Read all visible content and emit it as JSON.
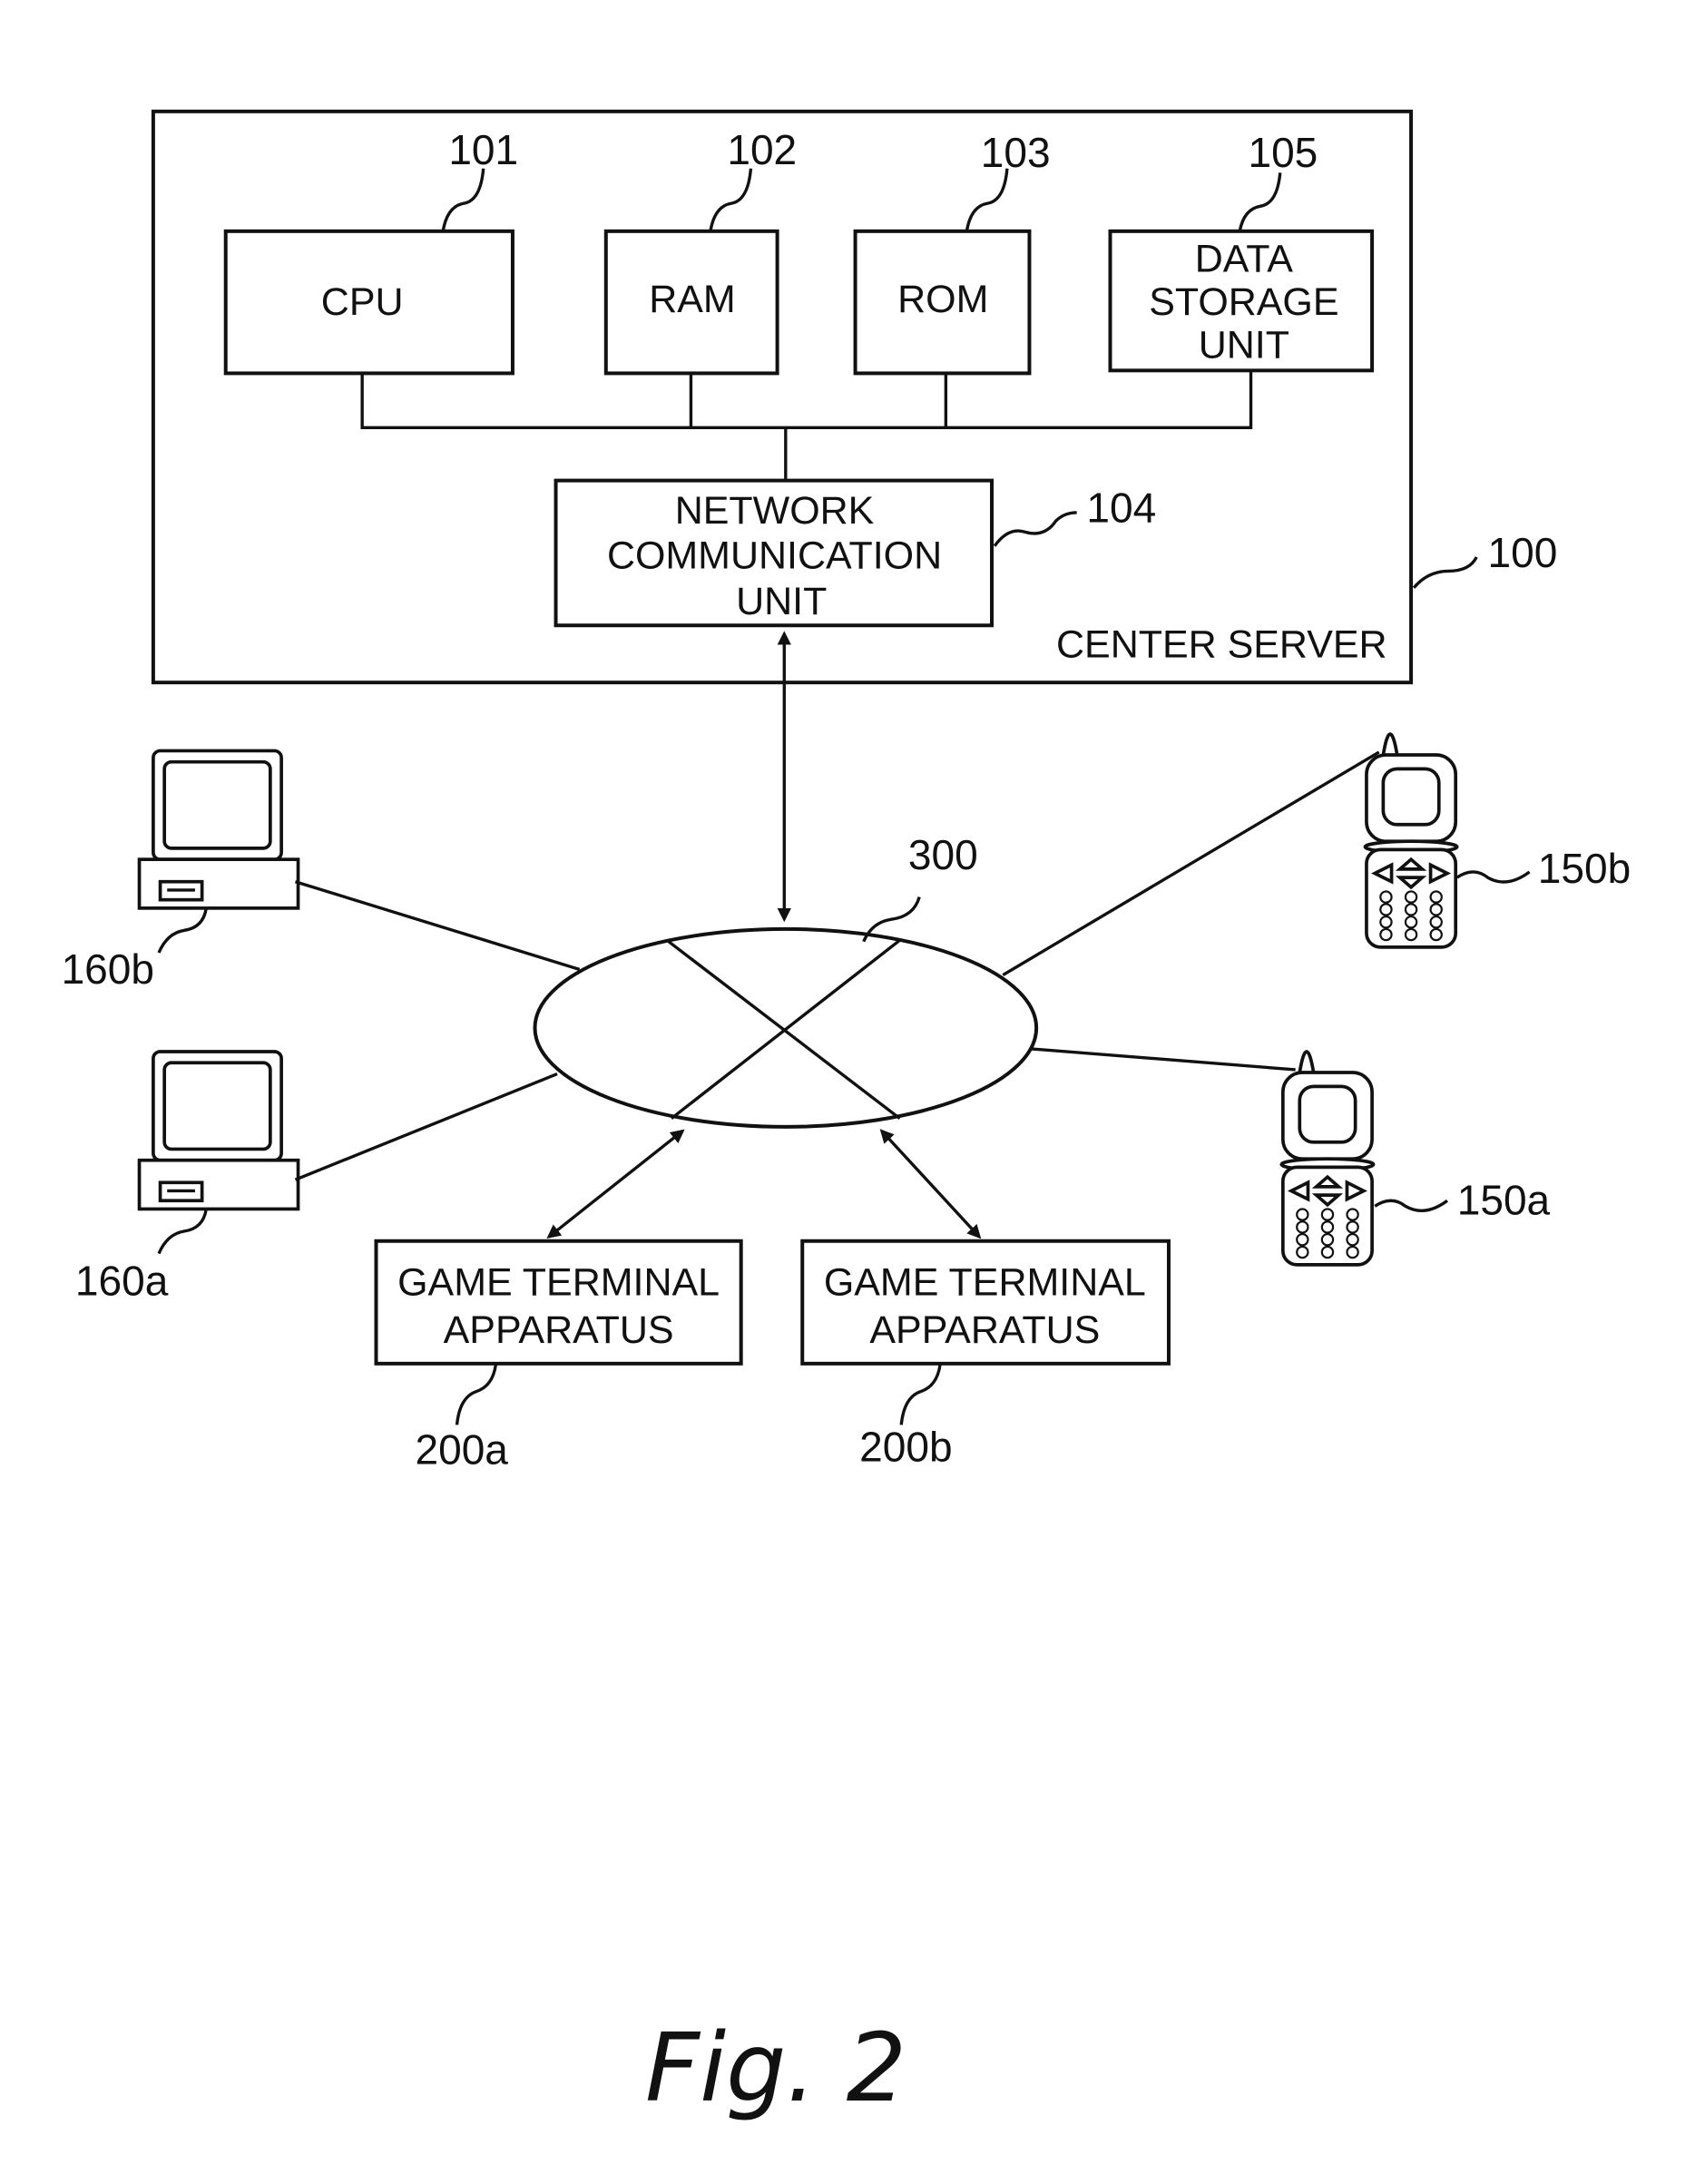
{
  "figure": {
    "caption": "Fig. 2",
    "server": {
      "ref": "100",
      "label": "CENTER SERVER",
      "components": [
        {
          "ref": "101",
          "lines": [
            "CPU"
          ]
        },
        {
          "ref": "102",
          "lines": [
            "RAM"
          ]
        },
        {
          "ref": "103",
          "lines": [
            "ROM"
          ]
        },
        {
          "ref": "105",
          "lines": [
            "DATA",
            "STORAGE",
            "UNIT"
          ]
        }
      ],
      "network_unit": {
        "ref": "104",
        "lines": [
          "NETWORK",
          "COMMUNICATION",
          "UNIT"
        ]
      }
    },
    "network": {
      "ref": "300"
    },
    "terminals": [
      {
        "ref": "200a",
        "lines": [
          "GAME TERMINAL",
          "APPARATUS"
        ]
      },
      {
        "ref": "200b",
        "lines": [
          "GAME TERMINAL",
          "APPARATUS"
        ]
      }
    ],
    "pcs": [
      {
        "ref": "160b",
        "icon": "desktop-computer-icon"
      },
      {
        "ref": "160a",
        "icon": "desktop-computer-icon"
      }
    ],
    "phones": [
      {
        "ref": "150b",
        "icon": "mobile-phone-icon"
      },
      {
        "ref": "150a",
        "icon": "mobile-phone-icon"
      }
    ]
  }
}
